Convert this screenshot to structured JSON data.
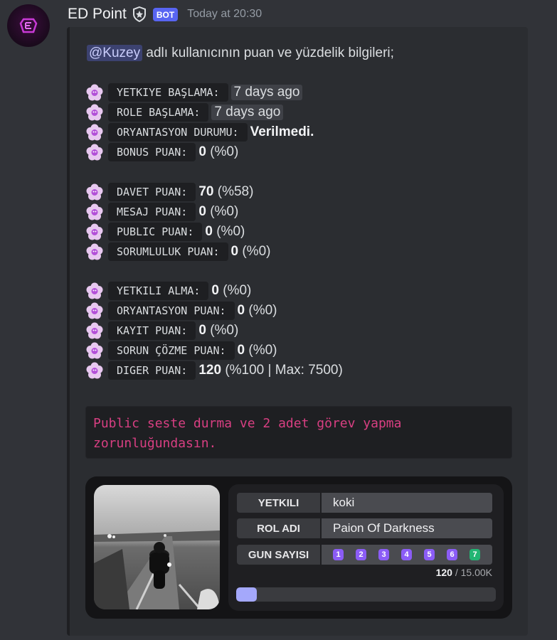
{
  "message": {
    "username": "ED Point",
    "bot_tag": "BOT",
    "timestamp": "Today at 20:30"
  },
  "embed": {
    "mention": "@Kuzey",
    "intro_text": "adlı kullanıcının puan ve yüzdelik bilgileri;",
    "rows": [
      {
        "label": "YETKIYE BAŞLAMA:",
        "value": "7 days ago",
        "style": "box"
      },
      {
        "label": "ROLE BAŞLAMA:",
        "value": "7 days ago",
        "style": "box"
      },
      {
        "label": "ORYANTASYON DURUMU:",
        "bold": "Verilmedi.",
        "rest": ""
      },
      {
        "label": "BONUS PUAN:",
        "bold": "0",
        "rest": " (%0)"
      },
      {
        "label": "DAVET PUAN:",
        "bold": "70",
        "rest": " (%58)"
      },
      {
        "label": "MESAJ PUAN:",
        "bold": "0",
        "rest": " (%0)"
      },
      {
        "label": "PUBLIC PUAN:",
        "bold": "0",
        "rest": " (%0)"
      },
      {
        "label": "SORUMLULUK PUAN:",
        "bold": "0",
        "rest": " (%0)"
      },
      {
        "label": "YETKILI ALMA:",
        "bold": "0",
        "rest": " (%0)"
      },
      {
        "label": "ORYANTASYON PUAN:",
        "bold": "0",
        "rest": " (%0)"
      },
      {
        "label": "KAYIT PUAN:",
        "bold": "0",
        "rest": " (%0)"
      },
      {
        "label": "SORUN ÇÖZME PUAN:",
        "bold": "0",
        "rest": " (%0)"
      },
      {
        "label": "DIGER PUAN:",
        "bold": "120",
        "rest": " (%100 | Max: 7500)"
      }
    ],
    "notice": "Public seste durma ve 2 adet görev yapma zorunluğundasın."
  },
  "card": {
    "yetkili_label": "YETKILI",
    "yetkili_value": "koki",
    "rol_label": "ROL ADI",
    "rol_value": "Paion Of Darkness",
    "gun_label": "GUN SAYISI",
    "days": [
      "1",
      "2",
      "3",
      "4",
      "5",
      "6",
      "7"
    ],
    "completed_day": "7",
    "progress_current": "120",
    "progress_max": "/ 15.00K",
    "progress_fraction": 0.008,
    "colors": {
      "day": "#8b5cf6",
      "day_done": "#22b573",
      "bar_fill": "#a4a8fb",
      "notice": "#d83f82",
      "mention_bg": "#3c4270"
    }
  }
}
